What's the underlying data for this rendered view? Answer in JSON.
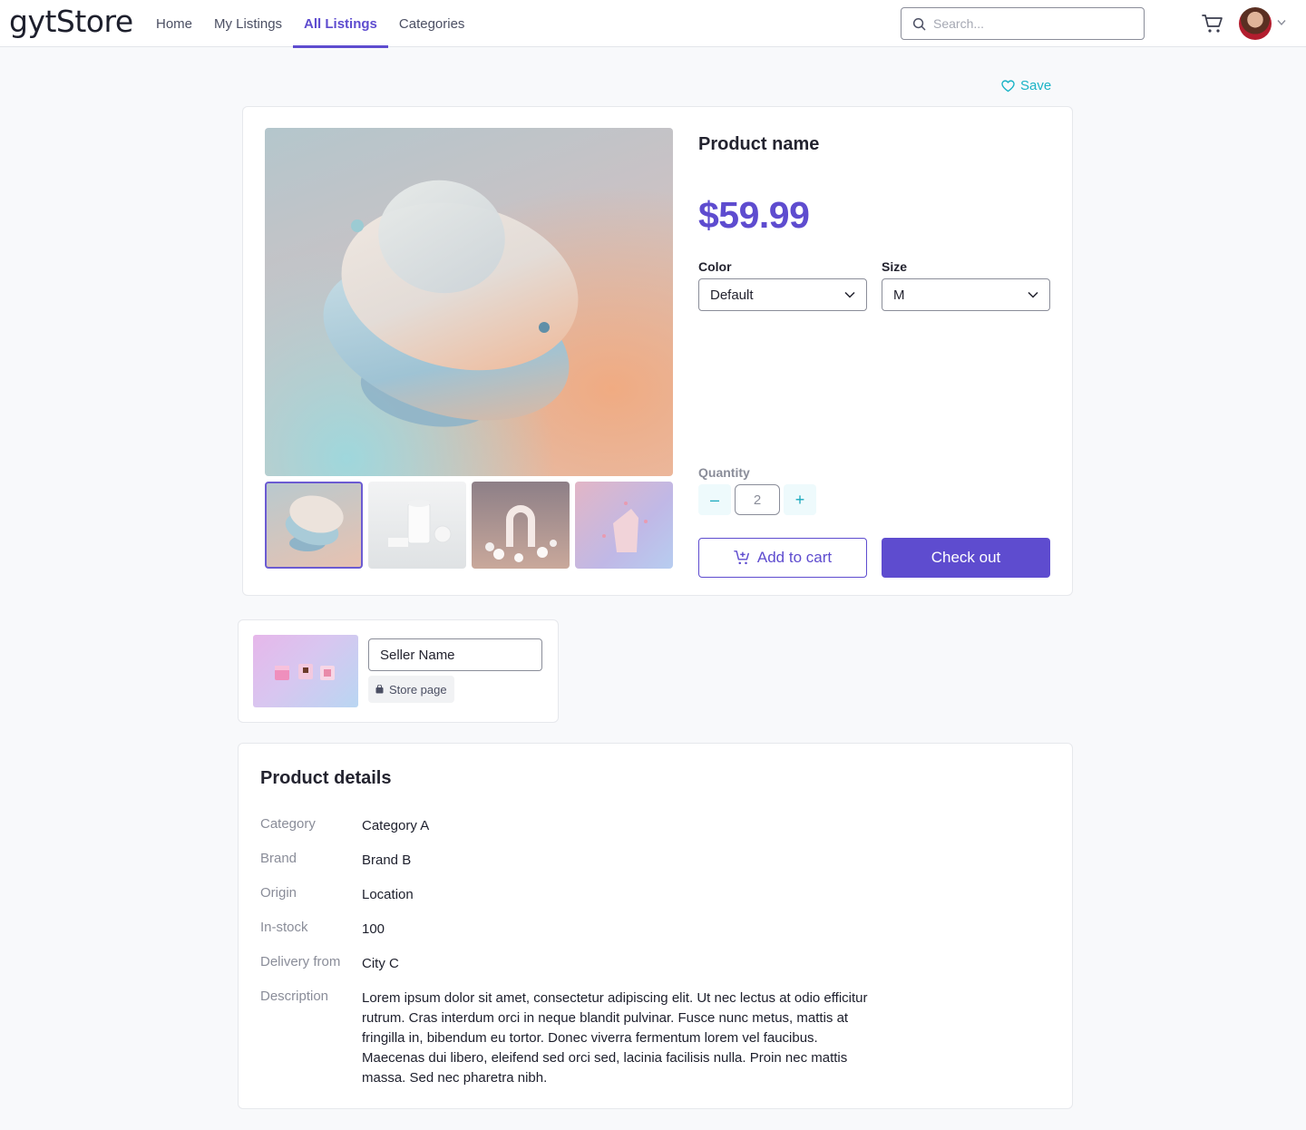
{
  "app": {
    "logo": "gytStore"
  },
  "nav": {
    "items": [
      {
        "label": "Home"
      },
      {
        "label": "My Listings"
      },
      {
        "label": "All Listings",
        "active": true
      },
      {
        "label": "Categories"
      }
    ]
  },
  "search": {
    "placeholder": "Search..."
  },
  "header_icons": {
    "cart": "shopping-cart-icon",
    "avatar": "user-avatar",
    "caret": "caret-down-icon"
  },
  "save": {
    "label": "Save",
    "icon": "heart-outline-icon"
  },
  "product": {
    "name": "Product name",
    "price": "$59.99",
    "color_label": "Color",
    "color_value": "Default",
    "size_label": "Size",
    "size_value": "M",
    "quantity_label": "Quantity",
    "quantity": "2",
    "minus": "–",
    "plus": "+",
    "add_to_cart": "Add to cart",
    "check_out": "Check out",
    "thumbnails": [
      "abstract-discs",
      "white-cylinder",
      "arch-spheres",
      "pink-block"
    ],
    "selected_thumbnail": 0
  },
  "seller": {
    "name": "Seller Name",
    "store_page": "Store page"
  },
  "details": {
    "title": "Product details",
    "rows": [
      {
        "key": "Category",
        "value": "Category A"
      },
      {
        "key": "Brand",
        "value": "Brand B"
      },
      {
        "key": "Origin",
        "value": "Location"
      },
      {
        "key": "In-stock",
        "value": "100"
      },
      {
        "key": "Delivery from",
        "value": "City C"
      },
      {
        "key": "Description",
        "value": "Lorem ipsum dolor sit amet, consectetur adipiscing elit. Ut nec lectus at odio efficitur rutrum. Cras interdum orci in neque blandit pulvinar. Fusce nunc metus, mattis at fringilla in, bibendum eu tortor. Donec viverra fermentum lorem vel faucibus. Maecenas dui libero, eleifend sed orci sed, lacinia facilisis nulla. Proin nec mattis massa. Sed nec pharetra nibh."
      }
    ]
  },
  "colors": {
    "accent": "#5e4ccf",
    "teal": "#19b3c6"
  }
}
